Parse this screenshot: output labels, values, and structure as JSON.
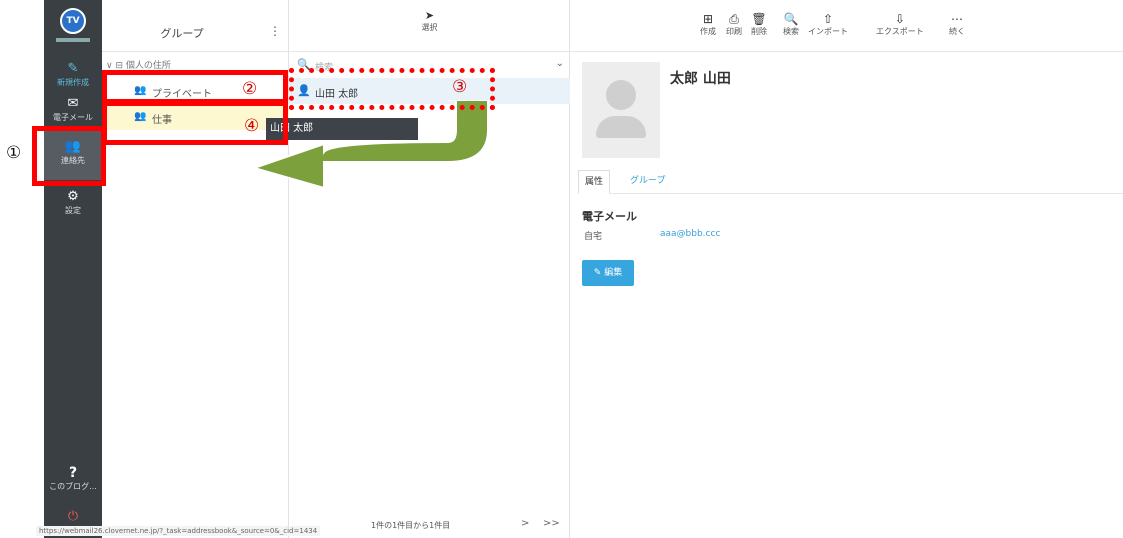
{
  "nav": {
    "logo_text": "TV",
    "items": [
      {
        "icon": "✎",
        "label": "新規作成"
      },
      {
        "icon": "✉",
        "label": "電子メール"
      },
      {
        "icon": "👥",
        "label": "連絡先"
      },
      {
        "icon": "⚙",
        "label": "設定"
      },
      {
        "icon": "?",
        "label": "このブログ..."
      },
      {
        "icon": "⏻",
        "label": ""
      }
    ]
  },
  "groups": {
    "title": "グループ",
    "kebab": "⋮",
    "address_book": "∨ ⊟ 個人の住所",
    "items": [
      {
        "icon": "👥",
        "label": "プライベート"
      },
      {
        "icon": "👥",
        "label": "仕事"
      }
    ]
  },
  "list": {
    "select_icon": "➤",
    "select_label": "選択",
    "search_icon": "🔍",
    "search_placeholder": "検索",
    "search_menu_icon": "⌄",
    "contact_icon": "👤",
    "contact_name": "山田 太郎",
    "drag_tooltip": "山田 太郎",
    "pager_info": "1件の1件目から1件目",
    "pager_next": ">",
    "pager_last": ">>",
    "status_url": "https://webmail26.clovernet.ne.jp/?_task=addressbook&_source=0&_cid=1434"
  },
  "toolbar": {
    "buttons": [
      {
        "icon": "⊞",
        "label": "作成"
      },
      {
        "icon": "⎙",
        "label": "印刷"
      },
      {
        "icon": "🗑",
        "label": "削除"
      },
      {
        "icon": "🔍",
        "label": "検索"
      },
      {
        "icon": "⇧",
        "label": "インポート"
      },
      {
        "icon": "⇩",
        "label": "エクスポート"
      },
      {
        "icon": "⋯",
        "label": "続く"
      }
    ]
  },
  "detail": {
    "name": "太郎 山田",
    "tabs": [
      "属性",
      "グループ"
    ],
    "section_title": "電子メール",
    "field_label": "自宅",
    "field_value": "aaa@bbb.ccc",
    "edit_label": "✎ 編集"
  },
  "annotations": {
    "n1": "①",
    "n2": "②",
    "n3": "③",
    "n4": "④"
  },
  "colors": {
    "annotation": "#ff0000",
    "arrow_fill": "#7ca03c",
    "nav_bg": "#3a3f44",
    "accent": "#37a6de"
  }
}
